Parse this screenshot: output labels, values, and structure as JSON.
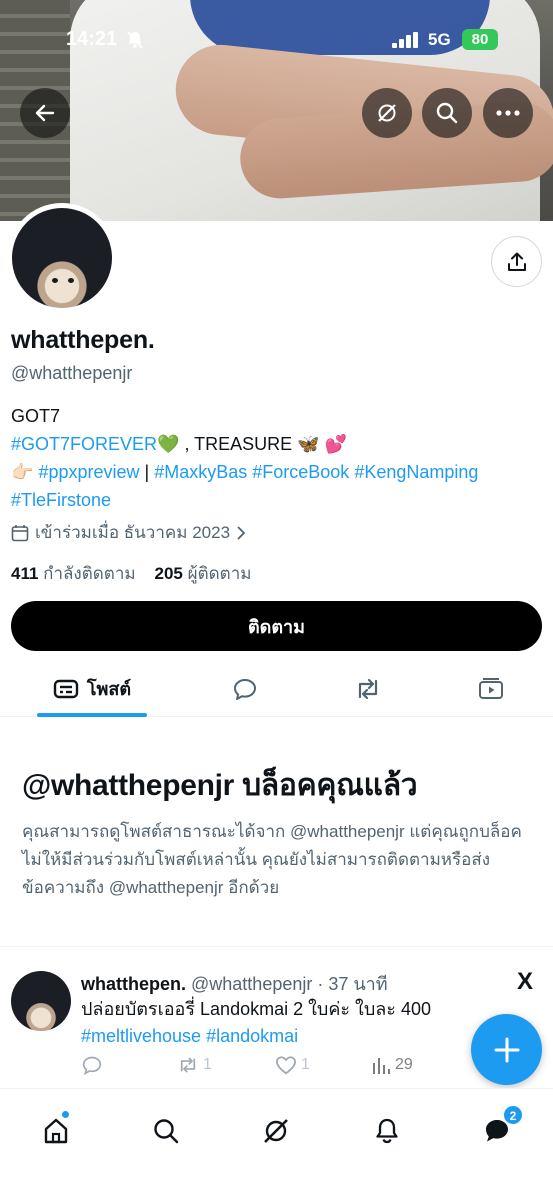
{
  "status_bar": {
    "time": "14:21",
    "network": "5G",
    "battery": "80"
  },
  "profile": {
    "name": "whatthepen.",
    "handle": "@whatthepenjr",
    "bio_line1": "GOT7",
    "bio_tag1": "#GOT7FOREVER",
    "bio_emoji1": "💚",
    "bio_text2": " , TREASURE ",
    "bio_emoji2": "🦋 💕",
    "bio_emoji3": "👉🏻",
    "bio_tag2": "#ppxpreview",
    "bio_sep": " | ",
    "bio_tag3": "#MaxkyBas",
    "bio_tag4": "#ForceBook",
    "bio_tag5": "#KengNamping",
    "bio_tag6": "#TleFirstone",
    "joined": "เข้าร่วมเมื่อ ธันวาคม 2023",
    "following_count": "411",
    "following_label": "กำลังติดตาม",
    "followers_count": "205",
    "followers_label": "ผู้ติดตาม",
    "follow_button": "ติดตาม"
  },
  "tabs": {
    "posts_label": "โพสต์"
  },
  "blocked": {
    "title": "@whatthepenjr บล็อคคุณแล้ว",
    "text": "คุณสามารถดูโพสต์สาธารณะได้จาก @whatthepenjr แต่คุณถูกบล็อคไม่ให้มีส่วนร่วมกับโพสต์เหล่านั้น คุณยังไม่สามารถติดตามหรือส่งข้อความถึง @whatthepenjr อีกด้วย"
  },
  "tweet": {
    "name": "whatthepen.",
    "handle_time": " @whatthepenjr · 37 นาที",
    "text": "ปล่อยบัตรเออรี่ Landokmai 2 ใบค่ะ ใบละ 400",
    "tag1": "#meltlivehouse",
    "tag2": "#landokmai",
    "retweets": "1",
    "likes": "1",
    "views": "29",
    "source_icon": "X"
  },
  "nav": {
    "messages_badge": "2"
  },
  "colors": {
    "accent": "#1d9bf0",
    "text": "#0f1419",
    "muted": "#536471",
    "battery": "#34c759"
  }
}
